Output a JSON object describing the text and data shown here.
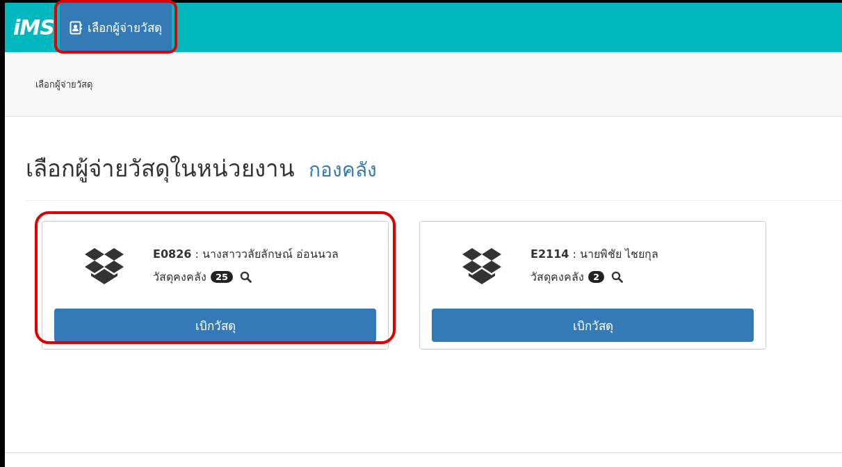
{
  "navbar": {
    "logo": "iMS",
    "menu_item": {
      "label": "เลือกผู้จ่ายวัสดุ",
      "selected": true,
      "highlighted": true
    }
  },
  "breadcrumb": "เลือกผู้จ่ายวัสดุ",
  "heading": {
    "title": "เลือกผู้จ่ายวัสดุในหน่วยงาน",
    "unit": "กองคลัง"
  },
  "cards": [
    {
      "code": "E0826",
      "separator": ":",
      "name": "นางสาววลัยลักษณ์ อ่อนนวล",
      "stock_label": "วัสดุคงคลัง",
      "count": "25",
      "button": "เบิกวัสดุ",
      "highlighted": true
    },
    {
      "code": "E2114",
      "separator": ":",
      "name": "นายพิชัย ไชยกุล",
      "stock_label": "วัสดุคงคลัง",
      "count": "2",
      "button": "เบิกวัสดุ",
      "highlighted": false
    }
  ]
}
